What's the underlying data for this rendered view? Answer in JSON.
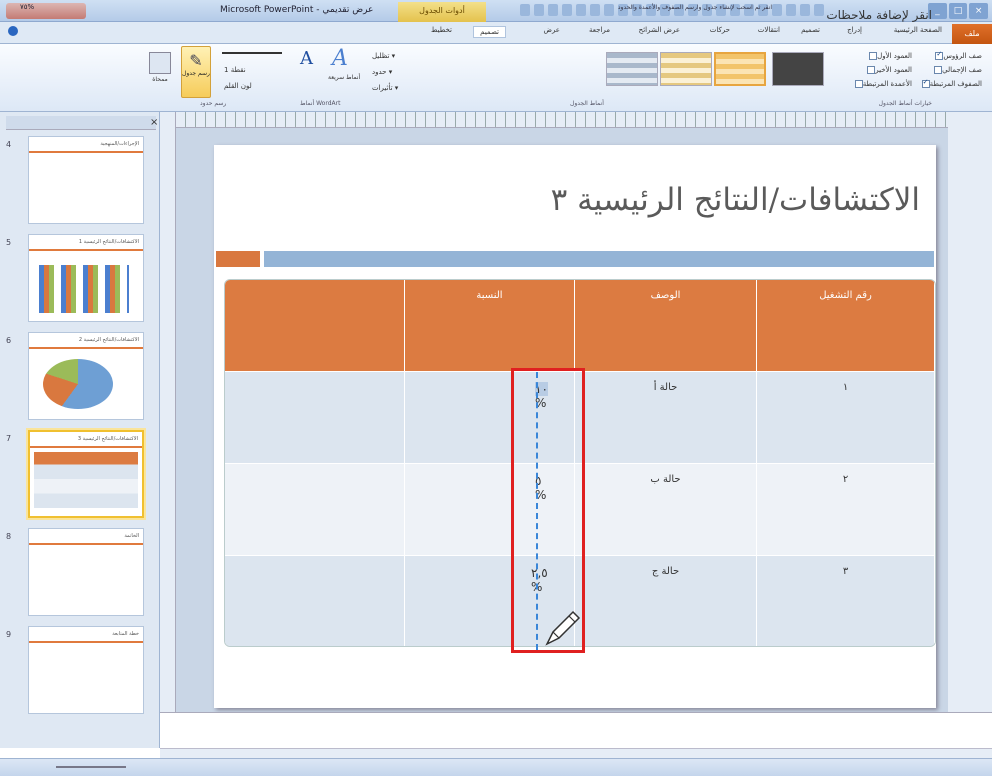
{
  "window": {
    "app_title": "Microsoft PowerPoint - عرض تقديمي",
    "context_tab_group": "أدوات الجدول",
    "controls": [
      "_",
      "□",
      "×"
    ]
  },
  "tabs": [
    {
      "label": "ملف"
    },
    {
      "label": "الصفحة الرئيسية"
    },
    {
      "label": "إدراج"
    },
    {
      "label": "تصميم"
    },
    {
      "label": "انتقالات"
    },
    {
      "label": "حركات"
    },
    {
      "label": "عرض الشرائح"
    },
    {
      "label": "مراجعة"
    },
    {
      "label": "عرض"
    },
    {
      "label": "تصميم"
    },
    {
      "label": "تخطيط"
    }
  ],
  "ribbon": {
    "style_options": {
      "header_row": "صف الرؤوس",
      "total_row": "صف الإجمالي",
      "banded_rows": "الصفوف المرتبطة",
      "first_column": "العمود الأول",
      "last_column": "العمود الأخير",
      "banded_columns": "الأعمدة المرتبطة",
      "group_label": "خيارات أنماط الجدول"
    },
    "table_styles_label": "أنماط الجدول",
    "shading": "تظليل",
    "borders": "حدود",
    "effects": "تأثيرات",
    "wordart_label": "أنماط WordArt",
    "quick_styles": "أنماط سريعة",
    "pen_size": "1 نقطة",
    "pen_color": "لون القلم",
    "draw_table": "رسم جدول",
    "eraser": "ممحاة",
    "draw_borders_label": "رسم حدود"
  },
  "slides": [
    {
      "num": "4",
      "title": "الإجراءات/المنهجية"
    },
    {
      "num": "5",
      "title": "الاكتشافات/النتائج الرئيسية 1"
    },
    {
      "num": "6",
      "title": "الاكتشافات/النتائج الرئيسية 2"
    },
    {
      "num": "7",
      "title": "الاكتشافات/النتائج الرئيسية 3"
    },
    {
      "num": "8",
      "title": "الخاتمة"
    },
    {
      "num": "9",
      "title": "خطة المتابعة"
    }
  ],
  "slide": {
    "title": "الاكتشافات/النتائج الرئيسية ٣",
    "table": {
      "headers": [
        "رقم التشغيل",
        "الوصف",
        "النسبة",
        ""
      ],
      "rows": [
        {
          "num": "١",
          "desc": "حالة أ",
          "pct": "١٠",
          "unit": "%"
        },
        {
          "num": "٢",
          "desc": "حالة ب",
          "pct": "٥",
          "unit": "%"
        },
        {
          "num": "٣",
          "desc": "حالة ج",
          "pct": "٢,٥",
          "unit": "%"
        }
      ]
    }
  },
  "notes_placeholder": "انقر لإضافة ملاحظات",
  "status": {
    "hint": "انقر ثم اسحب لإنشاء جدول وارسم الصفوف والأعمدة والحدود",
    "zoom": "٧٥%"
  },
  "colors": {
    "accent_orange": "#dc7b41",
    "accent_blue": "#94b4d6",
    "highlight_red": "#e02020"
  }
}
